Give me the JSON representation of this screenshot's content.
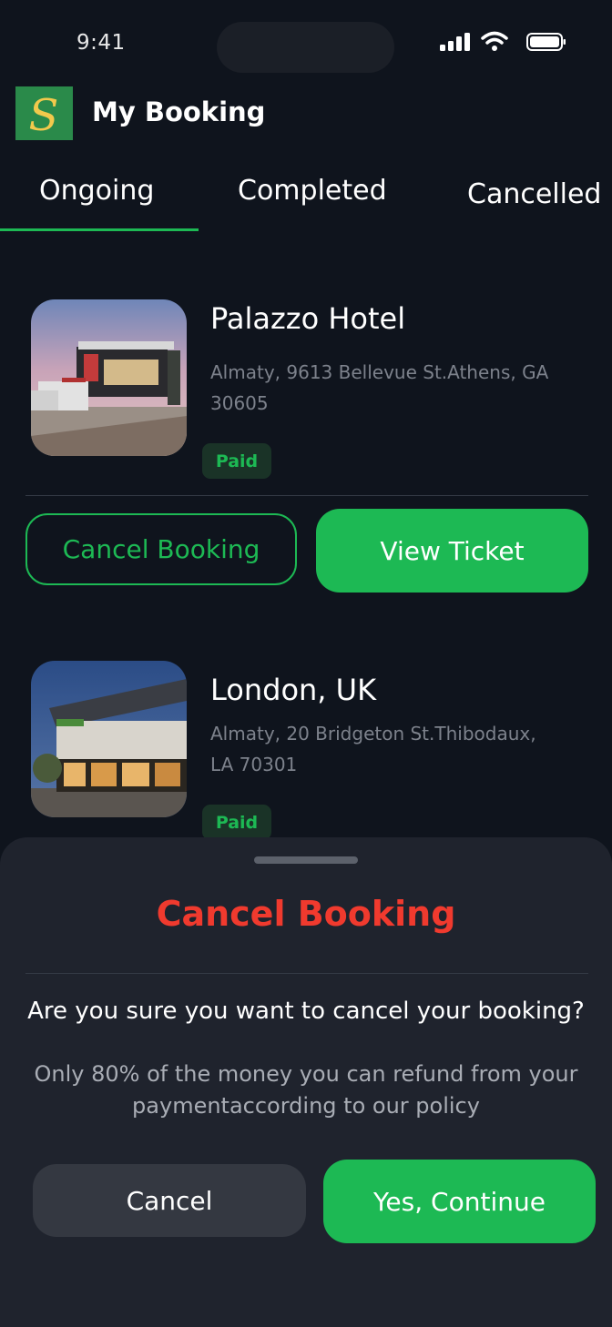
{
  "status_bar": {
    "time": "9:41"
  },
  "header": {
    "logo_letter": "S",
    "title": "My Booking"
  },
  "tabs": [
    {
      "label": "Ongoing",
      "active": true
    },
    {
      "label": "Completed",
      "active": false
    },
    {
      "label": "Cancelled",
      "active": false
    }
  ],
  "bookings": [
    {
      "name": "Palazzo Hotel",
      "address": "Almaty, 9613 Bellevue St.Athens, GA 30605",
      "status": "Paid"
    },
    {
      "name": "London, UK",
      "address": "Almaty, 20 Bridgeton St.Thibodaux, LA 70301",
      "status": "Paid"
    }
  ],
  "card_actions": {
    "cancel_label": "Cancel Booking",
    "view_label": "View Ticket"
  },
  "sheet": {
    "title": "Cancel Booking",
    "question": "Are you sure you want to cancel your booking?",
    "note": "Only 80% of the money you can refund from your paymentaccording to our policy",
    "cancel_label": "Cancel",
    "continue_label": "Yes, Continue"
  },
  "colors": {
    "accent": "#1db954",
    "danger": "#f03a2e",
    "background": "#0f141d",
    "sheet": "#1f232d"
  }
}
